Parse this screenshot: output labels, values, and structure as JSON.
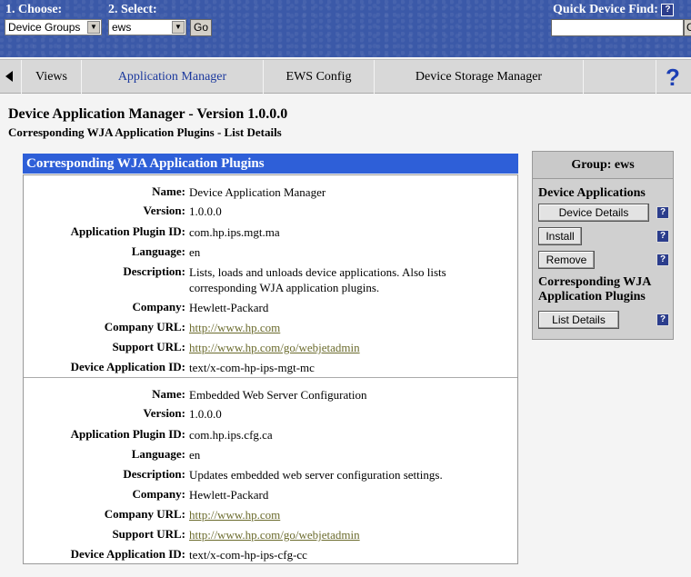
{
  "topbar": {
    "choose_label": "1. Choose:",
    "select_label": "2. Select:",
    "choose_value": "Device Groups",
    "select_value": "ews",
    "go_label": "Go",
    "quick_find_label": "Quick Device Find:",
    "quick_find_value": "",
    "quick_find_button": "G",
    "help_glyph": "?"
  },
  "tabs": [
    {
      "label": "Views"
    },
    {
      "label": "Application Manager"
    },
    {
      "label": "EWS Config"
    },
    {
      "label": "Device Storage Manager"
    }
  ],
  "help_big": "?",
  "page": {
    "title": "Device Application Manager - Version 1.0.0.0",
    "subtitle": "Corresponding WJA Application Plugins - List Details",
    "panel_title": "Corresponding WJA Application Plugins"
  },
  "labels": {
    "name": "Name:",
    "version": "Version:",
    "plugin_id": "Application Plugin ID:",
    "language": "Language:",
    "description": "Description:",
    "company": "Company:",
    "company_url": "Company URL:",
    "support_url": "Support URL:",
    "device_app_id": "Device Application ID:"
  },
  "plugins": [
    {
      "name": "Device Application Manager",
      "version": "1.0.0.0",
      "plugin_id": "com.hp.ips.mgt.ma",
      "language": "en",
      "description": "Lists, loads and unloads device applications. Also lists corresponding WJA application plugins.",
      "company": "Hewlett-Packard",
      "company_url": "http://www.hp.com",
      "support_url": "http://www.hp.com/go/webjetadmin",
      "device_app_id": "text/x-com-hp-ips-mgt-mc"
    },
    {
      "name": "Embedded Web Server Configuration",
      "version": "1.0.0.0",
      "plugin_id": "com.hp.ips.cfg.ca",
      "language": "en",
      "description": "Updates embedded web server configuration settings.",
      "company": "Hewlett-Packard",
      "company_url": "http://www.hp.com",
      "support_url": "http://www.hp.com/go/webjetadmin",
      "device_app_id": "text/x-com-hp-ips-cfg-cc"
    }
  ],
  "side": {
    "group_title": "Group: ews",
    "section1": "Device Applications",
    "btn_device_details": "Device Details",
    "btn_install": "Install",
    "btn_remove": "Remove",
    "section2": "Corresponding WJA Application Plugins",
    "btn_list_details": "List Details",
    "help_glyph": "?"
  },
  "colors": {
    "topbar": "#3b59a8",
    "panel_header": "#2e5fd8",
    "link": "#6b6b2d",
    "active_tab": "#1d3a9e"
  }
}
